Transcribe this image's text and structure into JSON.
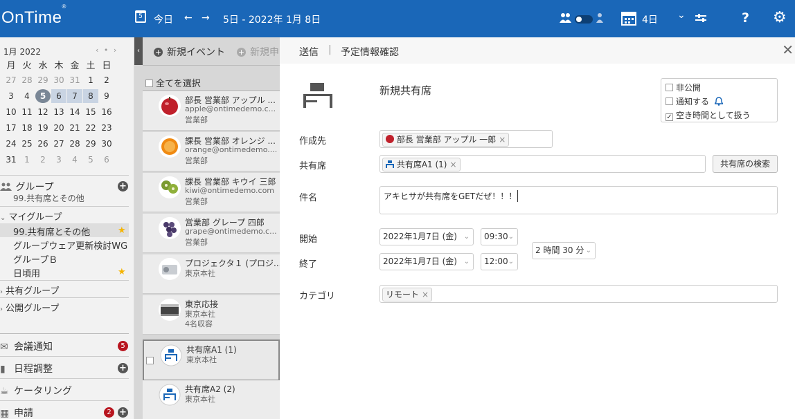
{
  "topbar": {
    "logo": "OnTime",
    "logo_reg": "®",
    "cal_icon_num": "5",
    "today": "今日",
    "prev_arrow": "←",
    "next_arrow": "→",
    "date_range": "5日 - 2022年 1月 8日",
    "view_days": "4日",
    "view_chevron": "⌄",
    "help": "?",
    "settings": "⚙"
  },
  "minical": {
    "month": "1月 2022",
    "nav": "‹ • ›",
    "dow": [
      "月",
      "火",
      "水",
      "木",
      "金",
      "土",
      "日"
    ],
    "weeks": [
      [
        "27",
        "28",
        "29",
        "30",
        "31",
        "1",
        "2"
      ],
      [
        "3",
        "4",
        "5",
        "6",
        "7",
        "8",
        "9"
      ],
      [
        "10",
        "11",
        "12",
        "13",
        "14",
        "15",
        "16"
      ],
      [
        "17",
        "18",
        "19",
        "20",
        "21",
        "22",
        "23"
      ],
      [
        "24",
        "25",
        "26",
        "27",
        "28",
        "29",
        "30"
      ],
      [
        "31",
        "1",
        "2",
        "3",
        "4",
        "5",
        "6"
      ]
    ]
  },
  "sidebar": {
    "group_title": "グループ",
    "group_sub": "99.共有席とその他",
    "my_groups": "マイグループ",
    "my_group_items": [
      "99.共有席とその他",
      "グループウェア更新検討WG",
      "グループＢ",
      "日頃用"
    ],
    "shared_groups": "共有グループ",
    "public_groups": "公開グループ",
    "meeting": "会議通知",
    "meeting_badge": "5",
    "schedule": "日程調整",
    "catering": "ケータリング",
    "request": "申請",
    "request_badge": "2"
  },
  "midlist": {
    "new_event": "新規イベント",
    "new_other": "新規申",
    "select_all": "全てを選択",
    "cards": [
      {
        "t1": "部長 営業部 アップル ...",
        "t2": "apple@ontimedemo.c...",
        "t3": "営業部"
      },
      {
        "t1": "課長 営業部 オレンジ ...",
        "t2": "orange@ontimedemo....",
        "t3": "営業部"
      },
      {
        "t1": "課長 営業部 キウイ 三郎",
        "t2": "kiwi@ontimedemo.com",
        "t3": "営業部"
      },
      {
        "t1": "営業部 グレープ 四郎",
        "t2": "grape@ontimedemo.c...",
        "t3": "営業部"
      },
      {
        "t1": "プロジェクタ１ (プロジ...",
        "t2": "東京本社",
        "t3": ""
      },
      {
        "t1": "東京応接",
        "t2": "東京本社",
        "t3": "4名収容"
      },
      {
        "t1": "共有席A1 (1)",
        "t2": "東京本社",
        "t3": ""
      },
      {
        "t1": "共有席A2 (2)",
        "t2": "東京本社",
        "t3": ""
      }
    ]
  },
  "panel": {
    "send": "送信",
    "divider": "|",
    "confirm": "予定情報確認",
    "close": "✕",
    "title": "新規共有席",
    "options": [
      "非公開",
      "通知する",
      "空き時間として扱う"
    ],
    "options_checked": [
      false,
      false,
      true
    ],
    "creator_label": "作成先",
    "creator_chip": "部長 営業部 アップル 一郎",
    "seat_label": "共有席",
    "seat_chip": "共有席A1 (1)",
    "seat_search": "共有席の検索",
    "subject_label": "件名",
    "subject_value": "アキヒサが共有席をGETだぜ！！！",
    "start_label": "開始",
    "start_date": "2022年1月7日 (金)",
    "start_time": "09:30",
    "end_label": "終了",
    "end_date": "2022年1月7日 (金)",
    "end_time": "12:00",
    "duration": "2 時間 30 分",
    "category_label": "カテゴリ",
    "category_chip": "リモート",
    "chip_x": "×",
    "dd": "⌄"
  },
  "colors": {
    "brand": "#1a67b8",
    "badge": "#b8151f",
    "star": "#f5b400"
  }
}
